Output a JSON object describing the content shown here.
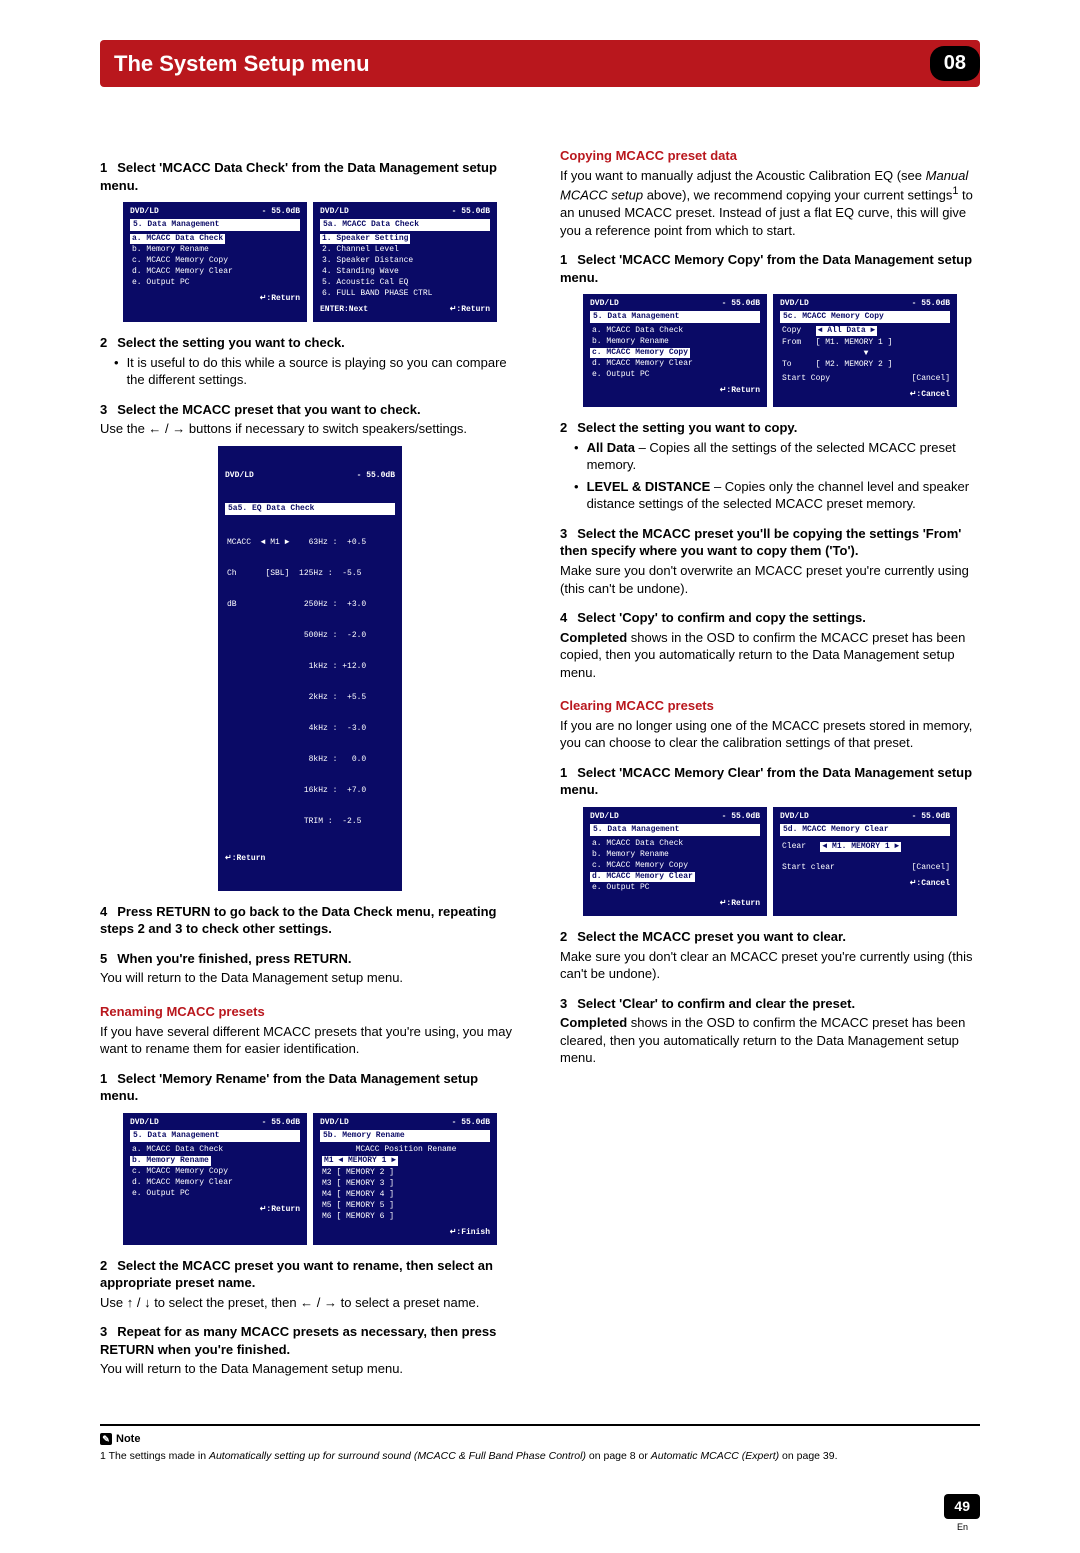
{
  "header": {
    "title": "The System Setup menu",
    "chapter": "08"
  },
  "page": {
    "num": "49",
    "lang": "En"
  },
  "left": {
    "step1": "Select 'MCACC Data Check' from the Data Management setup menu.",
    "osd1a": {
      "src": "DVD/LD",
      "db": "- 55.0dB",
      "title": "5. Data Management",
      "sel": "a. MCACC Data Check",
      "rows": [
        "b. Memory Rename",
        "c. MCACC Memory Copy",
        "d. MCACC Memory Clear",
        "e. Output PC"
      ],
      "bot_r": "↵:Return"
    },
    "osd1b": {
      "src": "DVD/LD",
      "db": "- 55.0dB",
      "title": "5a. MCACC Data Check",
      "sel": "1. Speaker Setting",
      "rows": [
        "2. Channel Level",
        "3. Speaker Distance",
        "4. Standing Wave",
        "5. Acoustic Cal EQ",
        "6. FULL BAND PHASE CTRL"
      ],
      "bot_l": "ENTER:Next",
      "bot_r": "↵:Return"
    },
    "step2": "Select the setting you want to check.",
    "step2_b": "It is useful to do this while a source is playing so you can compare the different settings.",
    "step3": "Select the MCACC preset that you want to check.",
    "step3_body": "Use the ← / → buttons if necessary to switch speakers/settings.",
    "osd2": {
      "src": "DVD/LD",
      "db": "- 55.0dB",
      "title": "5a5. EQ Data Check",
      "top1": "MCACC  ◄ M1 ►    63Hz :  +0.5",
      "top2": "Ch      [SBL]  125Hz :  -5.5",
      "rows": [
        "dB              250Hz :  +3.0",
        "                500Hz :  -2.0",
        "                 1kHz : +12.0",
        "                 2kHz :  +5.5",
        "                 4kHz :  -3.0",
        "                 8kHz :   0.0",
        "                16kHz :  +7.0",
        "                TRIM :  -2.5"
      ],
      "bot_l": "↵:Return"
    },
    "step4": "Press RETURN to go back to the Data Check menu, repeating steps 2 and 3 to check other settings.",
    "step5": "When you're finished, press RETURN.",
    "step5_body": "You will return to the Data Management setup menu.",
    "rename_head": "Renaming MCACC presets",
    "rename_intro": "If you have several different MCACC presets that you're using, you may want to rename them for easier identification.",
    "rstep1": "Select 'Memory Rename' from the Data Management setup menu.",
    "osd3a": {
      "src": "DVD/LD",
      "db": "- 55.0dB",
      "title": "5. Data Management",
      "pre": "a. MCACC Data Check",
      "sel": "b. Memory Rename",
      "rows": [
        "c. MCACC Memory Copy",
        "d. MCACC Memory Clear",
        "e. Output PC"
      ],
      "bot_r": "↵:Return"
    },
    "osd3b": {
      "src": "DVD/LD",
      "db": "- 55.0dB",
      "title": "5b. Memory Rename",
      "sub": "MCACC Position Rename",
      "sel_row": "M1  ◄ MEMORY  1 ►",
      "rows": [
        "M2  [ MEMORY  2 ]",
        "M3  [ MEMORY  3 ]",
        "M4  [ MEMORY  4 ]",
        "M5  [ MEMORY  5 ]",
        "M6  [ MEMORY  6 ]"
      ],
      "bot_r": "↵:Finish"
    },
    "rstep2": "Select the MCACC preset you want to rename, then select an appropriate preset name.",
    "rstep2_body_a": "Use ",
    "rstep2_body_b": " / ",
    "rstep2_body_c": " to select the preset, then ",
    "rstep2_body_d": " / ",
    "rstep2_body_e": " to select a preset name.",
    "rstep3": "Repeat for as many MCACC presets as necessary, then press RETURN when you're finished.",
    "rstep3_body": "You will return to the Data Management setup menu."
  },
  "right": {
    "copy_head": "Copying MCACC preset data",
    "copy_intro_a": "If you want to manually adjust the Acoustic Calibration EQ (see ",
    "copy_intro_it": "Manual MCACC setup",
    "copy_intro_b": " above), we recommend copying your current settings",
    "copy_intro_sup": "1",
    "copy_intro_c": " to an unused MCACC preset. Instead of just a flat EQ curve, this will give you a reference point from which to start.",
    "cstep1": "Select 'MCACC Memory Copy' from the Data Management setup menu.",
    "osd4a": {
      "src": "DVD/LD",
      "db": "- 55.0dB",
      "title": "5. Data Management",
      "pre": [
        "a. MCACC Data Check",
        "b. Memory Rename"
      ],
      "sel": "c. MCACC Memory Copy",
      "rows": [
        "d. MCACC Memory Clear",
        "e. Output PC"
      ],
      "bot_r": "↵:Return"
    },
    "osd4b": {
      "src": "DVD/LD",
      "db": "- 55.0dB",
      "title": "5c. MCACC Memory Copy",
      "rows_lbl": [
        "Copy",
        "From",
        "To"
      ],
      "rows_val": [
        "◄    All Data    ►",
        "[ M1. MEMORY 1 ]",
        "▼",
        "[ M2. MEMORY 2 ]"
      ],
      "start": "Start Copy",
      "cancel": "[Cancel]",
      "bot_r": "↵:Cancel"
    },
    "cstep2": "Select the setting you want to copy.",
    "b_all_h": "All Data",
    "b_all": " – Copies all the settings of the selected MCACC preset memory.",
    "b_lev_h": "LEVEL & DISTANCE",
    "b_lev": " – Copies only the channel level and speaker distance settings of the selected MCACC preset memory.",
    "cstep3": "Select the MCACC preset you'll be copying the settings 'From' then specify where you want to copy them ('To').",
    "cstep3_body": "Make sure you don't overwrite an MCACC preset you're currently using (this can't be undone).",
    "cstep4": "Select 'Copy' to confirm and copy the settings.",
    "cstep4_body_h": "Completed",
    "cstep4_body": " shows in the OSD to confirm the MCACC preset has been copied, then you automatically return to the Data Management setup menu.",
    "clear_head": "Clearing MCACC presets",
    "clear_intro": "If you are no longer using one of the MCACC presets stored in memory, you can choose to clear the calibration settings of that preset.",
    "clstep1": "Select 'MCACC Memory Clear' from the Data Management setup menu.",
    "osd5a": {
      "src": "DVD/LD",
      "db": "- 55.0dB",
      "title": "5. Data Management",
      "pre": [
        "a. MCACC Data Check",
        "b. Memory Rename",
        "c. MCACC Memory Copy"
      ],
      "sel": "d. MCACC Memory Clear",
      "rows": [
        "e. Output PC"
      ],
      "bot_r": "↵:Return"
    },
    "osd5b": {
      "src": "DVD/LD",
      "db": "- 55.0dB",
      "title": "5d. MCACC Memory Clear",
      "l1": "Clear",
      "r1": "◄ M1. MEMORY 1 ►",
      "start": "Start clear",
      "cancel": "[Cancel]",
      "bot_r": "↵:Cancel"
    },
    "clstep2": "Select the MCACC preset you want to clear.",
    "clstep2_body": "Make sure you don't clear an MCACC preset you're currently using (this can't be undone).",
    "clstep3": "Select 'Clear' to confirm and clear the preset.",
    "clstep3_body_h": "Completed",
    "clstep3_body": " shows in the OSD to confirm the MCACC preset has been cleared, then you automatically return to the Data Management setup menu."
  },
  "note": {
    "label": "Note",
    "text_a": "1 The settings made in ",
    "it1": "Automatically setting up for surround sound (MCACC & Full Band Phase Control)",
    "text_b": " on page 8 or ",
    "it2": "Automatic MCACC (Expert)",
    "text_c": " on page 39."
  }
}
